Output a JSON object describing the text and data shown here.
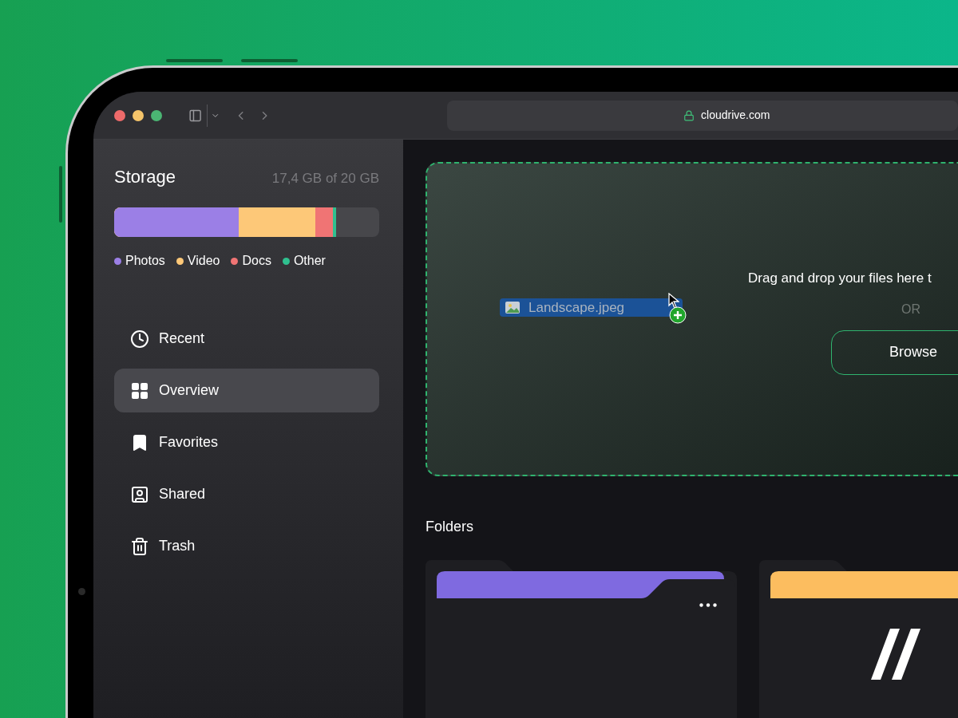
{
  "browser": {
    "address": "cloudrive.com"
  },
  "storage": {
    "title": "Storage",
    "usage": "17,4 GB of 20 GB",
    "bar": [
      {
        "level": 0.47
      },
      {
        "level": 0.76
      },
      {
        "level": 0.826
      },
      {
        "level": 0.838
      }
    ],
    "legend": [
      {
        "label": "Photos",
        "color": "#9b7fe6"
      },
      {
        "label": "Video",
        "color": "#fdc878"
      },
      {
        "label": "Docs",
        "color": "#f07474"
      },
      {
        "label": "Other",
        "color": "#2fc08f"
      }
    ]
  },
  "nav": [
    {
      "label": "Recent",
      "kind": "clock",
      "selected": false
    },
    {
      "label": "Overview",
      "kind": "grid",
      "selected": true
    },
    {
      "label": "Favorites",
      "kind": "bookmark",
      "selected": false
    },
    {
      "label": "Shared",
      "kind": "shared",
      "selected": false
    },
    {
      "label": "Trash",
      "kind": "trash",
      "selected": false
    }
  ],
  "dropzone": {
    "dragged_file": "Landscape.jpeg",
    "message": "Drag and drop your files here t",
    "separator": "OR",
    "button": "Browse"
  },
  "folders_title": "Folders",
  "folders": [
    {
      "color": "#7f6ae0",
      "kind": "menu"
    },
    {
      "color": "#fcbd5f",
      "kind": "logo"
    }
  ]
}
